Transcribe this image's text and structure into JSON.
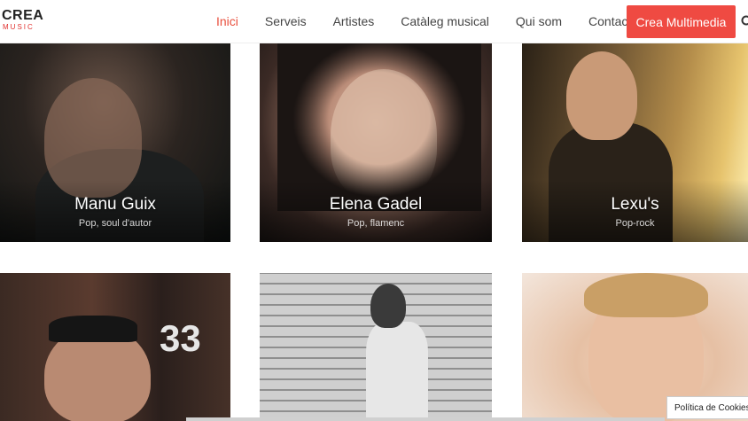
{
  "brand": {
    "top": "CREA",
    "bottom": "MUSIC"
  },
  "nav": {
    "items": [
      {
        "label": "Inici",
        "active": true
      },
      {
        "label": "Serveis"
      },
      {
        "label": "Artistes"
      },
      {
        "label": "Catàleg musical"
      },
      {
        "label": "Qui som"
      },
      {
        "label": "Contacte"
      }
    ],
    "cta_label": "Crea Multimedia"
  },
  "artists": [
    {
      "name": "Manu Guix",
      "genre": "Pop, soul d'autor"
    },
    {
      "name": "Elena Gadel",
      "genre": "Pop, flamenc"
    },
    {
      "name": "Lexu's",
      "genre": "Pop-rock"
    },
    {
      "name": "",
      "genre": "",
      "badge": "33"
    },
    {
      "name": "",
      "genre": ""
    },
    {
      "name": "",
      "genre": ""
    }
  ],
  "cookie_notice": "Política de Cookies",
  "colors": {
    "accent": "#ef4a42",
    "active_nav": "#e94f3d"
  }
}
